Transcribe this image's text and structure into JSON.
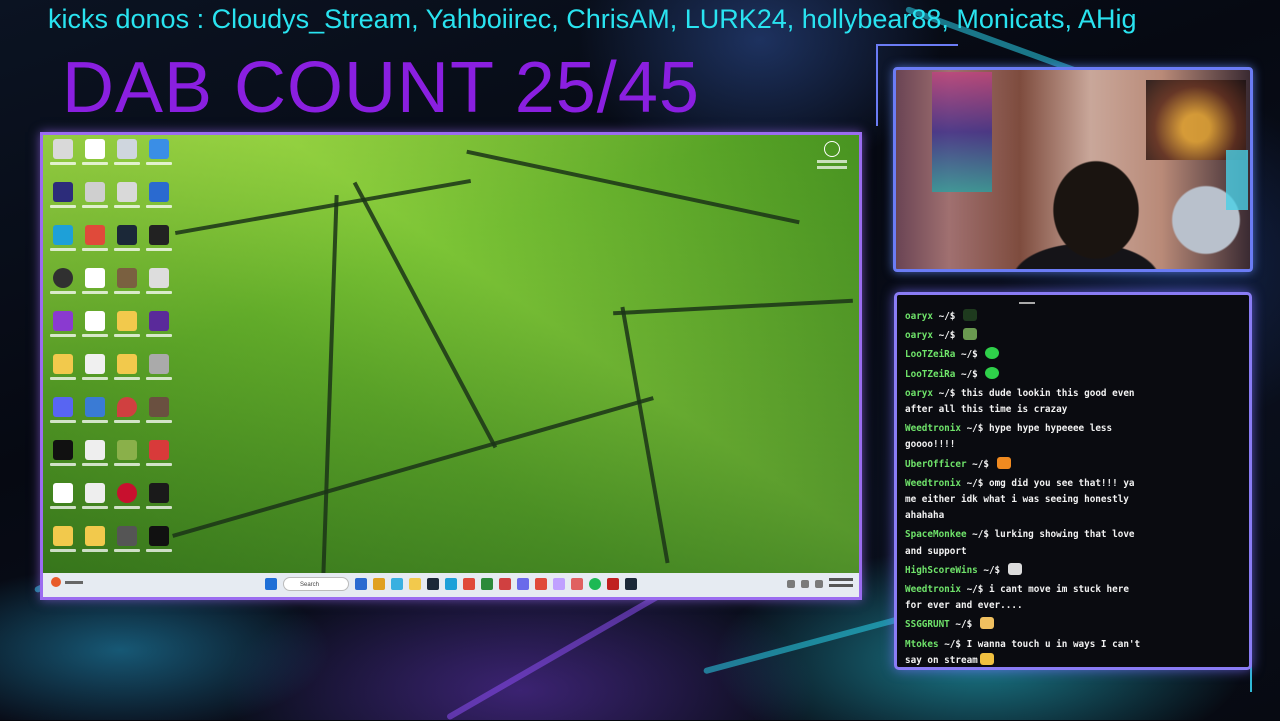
{
  "ticker": {
    "text": "kicks donos : Cloudys_Stream, Yahboiirec, ChrisAM, LURK24, hollybear88, Monicats, AHig"
  },
  "counter": {
    "label": "DAB COUNT 25/45"
  },
  "taskbar": {
    "search_placeholder": "Search"
  },
  "chat": {
    "messages": [
      {
        "user": "oaryx",
        "prompt": " ~/$ ",
        "text": "",
        "emote": "green-emote"
      },
      {
        "user": "oaryx",
        "prompt": " ~/$ ",
        "text": "",
        "emote": "frog-emote"
      },
      {
        "user": "LooTZeiRa",
        "prompt": " ~/$ ",
        "text": "",
        "emote": "green-smile-emote"
      },
      {
        "user": "LooTZeiRa",
        "prompt": " ~/$ ",
        "text": "",
        "emote": "green-smile-emote"
      },
      {
        "user": "oaryx",
        "prompt": " ~/$ ",
        "text": "this dude lookin this good even after all this time is crazay",
        "emote": ""
      },
      {
        "user": "Weedtronix",
        "prompt": " ~/$ ",
        "text": "hype hype hypeeee less goooo!!!!",
        "emote": ""
      },
      {
        "user": "UberOfficer",
        "prompt": " ~/$ ",
        "text": "",
        "emote": "explosion-emote"
      },
      {
        "user": "Weedtronix",
        "prompt": " ~/$ ",
        "text": "omg did you see that!!! ya me either idk what i was seeing honestly ahahaha",
        "emote": ""
      },
      {
        "user": "SpaceMonkee",
        "prompt": " ~/$ ",
        "text": "lurking showing that love and support",
        "emote": ""
      },
      {
        "user": "HighScoreWins",
        "prompt": " ~/$ ",
        "text": "",
        "emote": "eyes-emote"
      },
      {
        "user": "Weedtronix",
        "prompt": " ~/$ ",
        "text": "i cant move im stuck here for ever and ever....",
        "emote": ""
      },
      {
        "user": "SSGGRUNT",
        "prompt": " ~/$ ",
        "text": "",
        "emote": "flex-emote"
      },
      {
        "user": "Mtokes",
        "prompt": " ~/$ ",
        "text": "I wanna touch u in ways I can't say on stream",
        "emote": "blush-emote"
      }
    ]
  },
  "colors": {
    "ticker": "#29e3f0",
    "counter": "#8a1fe0",
    "chat_username": "#6fe36a",
    "frame_border": "#9b6cf0"
  }
}
